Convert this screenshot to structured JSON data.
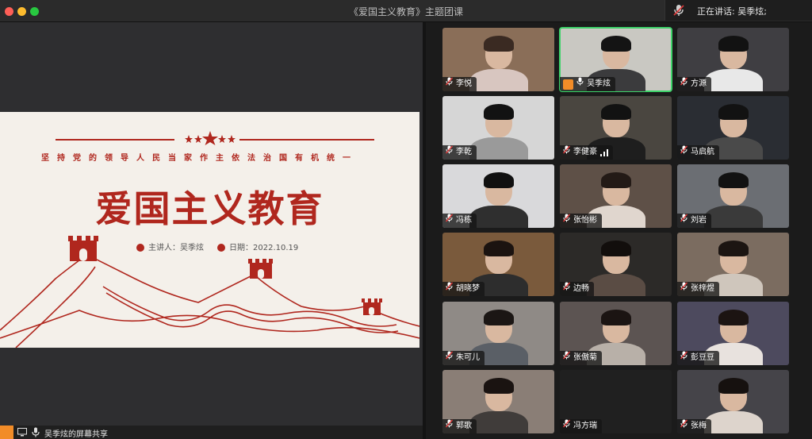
{
  "window": {
    "title": "《爱国主义教育》主题团课"
  },
  "speaking": {
    "label": "正在讲话: 吴季炫;"
  },
  "slide": {
    "subtitle": "坚持党的领导人民当家作主依法治国有机统一",
    "title": "爱国主义教育",
    "presenter": "主讲人：吴季炫",
    "date": "日期：2022.10.19"
  },
  "bottom_bar": {
    "share_label": "吴季炫的屏幕共享"
  },
  "participants": [
    {
      "name": "李悦",
      "bg": "#8a6e58",
      "shirt": "#d8c6c0",
      "hair": "#3a2a22"
    },
    {
      "name": "吴季炫",
      "bg": "#c9c8c2",
      "shirt": "#3b3b3d",
      "hair": "#141414",
      "host": true,
      "active": true
    },
    {
      "name": "方源",
      "bg": "#3f3e42",
      "shirt": "#e8e8e8",
      "hair": "#121212"
    },
    {
      "name": "李乾",
      "bg": "#d6d6d6",
      "shirt": "#9a9a9a",
      "hair": "#121212"
    },
    {
      "name": "李健豪",
      "bg": "#4a4640",
      "shirt": "#1e1e1e",
      "hair": "#121212",
      "signal": true
    },
    {
      "name": "马启航",
      "bg": "#2a2d33",
      "shirt": "#4a4a4a",
      "hair": "#121212"
    },
    {
      "name": "冯栋",
      "bg": "#d9d9db",
      "shirt": "#2f2f2f",
      "hair": "#101010"
    },
    {
      "name": "张怡彬",
      "bg": "#5e5047",
      "shirt": "#e0d6ce",
      "hair": "#231a16"
    },
    {
      "name": "刘岩",
      "bg": "#6b6e73",
      "shirt": "#3a3a3a",
      "hair": "#121212"
    },
    {
      "name": "胡晓梦",
      "bg": "#7a5a3c",
      "shirt": "#2d2d2d",
      "hair": "#1b1310"
    },
    {
      "name": "边畅",
      "bg": "#2c2a28",
      "shirt": "#5a4c44",
      "hair": "#120e0c"
    },
    {
      "name": "张梓煜",
      "bg": "#7b6c60",
      "shirt": "#cfc6bc",
      "hair": "#1c1512"
    },
    {
      "name": "朱可儿",
      "bg": "#8f8a86",
      "shirt": "#5a5f66",
      "hair": "#1b1614"
    },
    {
      "name": "张傲菊",
      "bg": "#5c5452",
      "shirt": "#b8b0a8",
      "hair": "#1b1412"
    },
    {
      "name": "彭豆豆",
      "bg": "#4d4a5e",
      "shirt": "#e8e2de",
      "hair": "#1c1412"
    },
    {
      "name": "郭歌",
      "bg": "#8a7e76",
      "shirt": "#403c3a",
      "hair": "#1a1311"
    },
    {
      "name": "冯方瑞",
      "bg": "#202020",
      "empty": true
    },
    {
      "name": "张梅",
      "bg": "#454449",
      "shirt": "#ddd4cc",
      "hair": "#16110f"
    }
  ],
  "colors": {
    "accent_red": "#b0271e",
    "active_border": "#3ed36a",
    "host_orange": "#f28c28"
  }
}
